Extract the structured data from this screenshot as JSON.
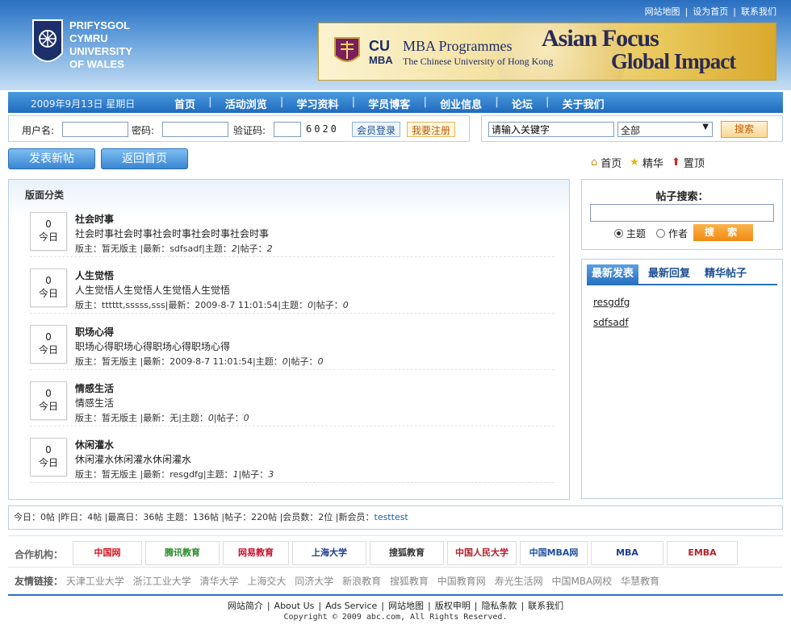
{
  "header": {
    "university_lines": [
      "PRIFYSGOL",
      "CYMRU",
      "UNIVERSITY",
      "OF WALES"
    ],
    "top_links": [
      "网站地图",
      "设为首页",
      "联系我们"
    ],
    "banner": {
      "cu": "CU",
      "mba": "MBA",
      "programmes": "MBA Programmes",
      "cuhk": "The Chinese University of Hong Kong",
      "asian_focus": "Asian Focus",
      "global_impact": "Global Impact"
    }
  },
  "nav": {
    "date": "2009年9月13日 星期日",
    "items": [
      "首页",
      "活动浏览",
      "学习资料",
      "学员博客",
      "创业信息",
      "论坛",
      "关于我们"
    ]
  },
  "login": {
    "username_label": "用户名:",
    "password_label": "密码:",
    "captcha_label": "验证码:",
    "captcha_code": "6020",
    "login_button": "会员登录",
    "register_button": "我要注册"
  },
  "search": {
    "keyword_value": "请输入关键字",
    "scope_selected": "全部",
    "button": "搜索"
  },
  "actions": {
    "new_post": "发表新帖",
    "back_home": "返回首页"
  },
  "legend": [
    {
      "label": "首页",
      "icon": "home-icon"
    },
    {
      "label": "精华",
      "icon": "star-icon"
    },
    {
      "label": "置顶",
      "icon": "arrow-up-icon"
    }
  ],
  "categories": {
    "title": "版面分类",
    "items": [
      {
        "count": "0",
        "today": "今日",
        "name": "社会时事",
        "desc": "社会时事社会时事社会时事社会时事社会时事",
        "moderator": "版主：暂无版主",
        "latest": "最新：sdfsadf",
        "topics": "2",
        "posts": "2"
      },
      {
        "count": "0",
        "today": "今日",
        "name": "人生觉悟",
        "desc": "人生觉悟人生觉悟人生觉悟人生觉悟",
        "moderator": "版主：tttttt,sssss,sss",
        "latest": "最新：2009-8-7 11:01:54",
        "topics": "0",
        "posts": "0"
      },
      {
        "count": "0",
        "today": "今日",
        "name": "职场心得",
        "desc": "职场心得职场心得职场心得职场心得",
        "moderator": "版主：暂无版主",
        "latest": "最新：2009-8-7 11:01:54",
        "topics": "0",
        "posts": "0"
      },
      {
        "count": "0",
        "today": "今日",
        "name": "情感生活",
        "desc": "情感生活",
        "moderator": "版主：暂无版主",
        "latest": "最新：无",
        "topics": "0",
        "posts": "0"
      },
      {
        "count": "0",
        "today": "今日",
        "name": "休闲灌水",
        "desc": "休闲灌水休闲灌水休闲灌水",
        "moderator": "版主：暂无版主",
        "latest": "最新：resgdfg",
        "topics": "1",
        "posts": "3"
      }
    ],
    "topic_label": "主题：",
    "post_label": "帖子："
  },
  "post_search": {
    "title": "帖子搜索：",
    "opt_subject": "主题",
    "opt_author": "作者",
    "button": "搜 索"
  },
  "latest": {
    "tabs": [
      "最新发表",
      "最新回复",
      "精华帖子"
    ],
    "links": [
      "resgdfg",
      "sdfsadf"
    ]
  },
  "stats": {
    "text": "今日：0帖 |昨日：4帖 |最高日：36帖 主题：136帖 |帖子：220帖 |会员数：2位 |新会员：",
    "new_member": "testtest"
  },
  "partners": {
    "label": "合作机构：",
    "logos": [
      "中国网",
      "腾讯教育",
      "网易教育",
      "上海大学",
      "搜狐教育",
      "中国人民大学",
      "中国MBA网",
      "MBA",
      "EMBA"
    ]
  },
  "friends": {
    "label": "友情链接：",
    "links": [
      "天津工业大学",
      "浙江工业大学",
      "清华大学",
      "上海交大",
      "同济大学",
      "新浪教育",
      "搜狐教育",
      "中国教育网",
      "寿光生活网",
      "中国MBA网校",
      "华慧教育"
    ]
  },
  "footer": {
    "links": [
      "网站简介",
      "About Us",
      "Ads Service",
      "网站地图",
      "版权申明",
      "隐私条款",
      "联系我们"
    ],
    "copyright": "Copyright © 2009 abc.com, All Rights Reserved."
  },
  "colors": {
    "nav_blue": "#1f6bbd",
    "border_blue": "#b9cfe4",
    "accent_orange": "#ef8a12"
  }
}
